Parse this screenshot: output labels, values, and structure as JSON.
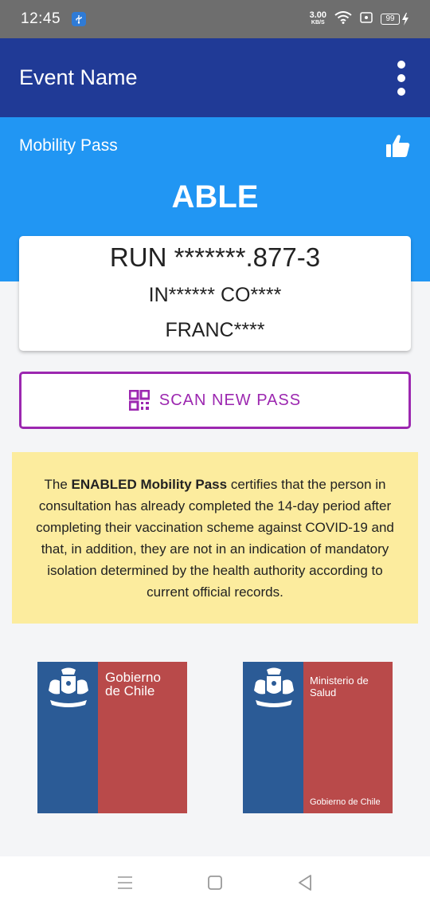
{
  "status_bar": {
    "time": "12:45",
    "net_speed_value": "3.00",
    "net_speed_unit": "KB/S",
    "battery": "99"
  },
  "app_bar": {
    "title": "Event Name"
  },
  "pass": {
    "label": "Mobility Pass",
    "status": "ABLE"
  },
  "card": {
    "run": "RUN *******.877-3",
    "name": "IN****** CO****",
    "surname": "FRANC****"
  },
  "scan_button": {
    "label": "SCAN NEW PASS"
  },
  "info": {
    "prefix": "The ",
    "emphasis": "ENABLED Mobility Pass",
    "body": " certifies that the person in consultation has already completed the 14-day period after completing their vaccination scheme against COVID-19 and that, in addition, they are not in an indication of mandatory isolation determined by the health authority according to current official records."
  },
  "logos": {
    "gobierno_line1": "Gobierno",
    "gobierno_line2": "de Chile",
    "ministerio_line1": "Ministerio de",
    "ministerio_line2": "Salud",
    "ministerio_footer": "Gobierno de Chile"
  },
  "colors": {
    "app_bar": "#203a96",
    "header": "#2196f3",
    "accent": "#9c27b0",
    "info_bg": "#fcec9e",
    "logo_blue": "#2b5b96",
    "logo_red": "#b94a4a"
  },
  "icons": {
    "usb": "usb-icon",
    "wifi": "wifi-icon",
    "battery": "battery-icon",
    "menu": "overflow-menu-icon",
    "thumbs": "thumbs-up-icon",
    "qr": "qr-code-icon"
  }
}
